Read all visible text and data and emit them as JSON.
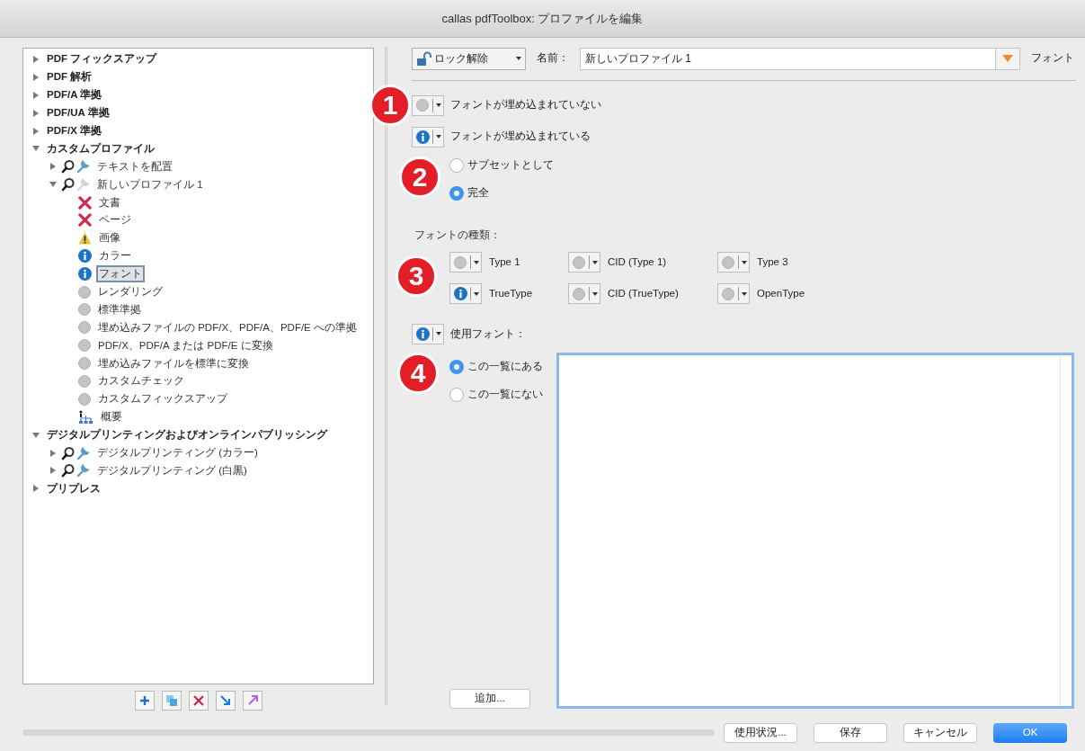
{
  "window": {
    "title": "callas pdfToolbox: プロファイルを編集"
  },
  "tree": [
    {
      "label": "PDF フィックスアップ",
      "expanded": false,
      "selected": false
    },
    {
      "label": "PDF 解析",
      "expanded": false,
      "selected": false
    },
    {
      "label": "PDF/A 準拠",
      "expanded": false,
      "selected": false
    },
    {
      "label": "PDF/UA 準拠",
      "expanded": false,
      "selected": false
    },
    {
      "label": "PDF/X 準拠",
      "expanded": false,
      "selected": false
    },
    {
      "label": "カスタムプロファイル",
      "expanded": true,
      "selected": false,
      "children": [
        {
          "label": "テキストを配置",
          "expanded": false,
          "selected": false,
          "kind": "profile",
          "fixups": true
        },
        {
          "label": "新しいプロファイル 1",
          "expanded": true,
          "selected": false,
          "kind": "profile",
          "fixups": false,
          "children": [
            {
              "label": "文書",
              "kind": "error",
              "selected": false
            },
            {
              "label": "ページ",
              "kind": "error",
              "selected": false
            },
            {
              "label": "画像",
              "kind": "warning",
              "selected": false
            },
            {
              "label": "カラー",
              "kind": "info",
              "selected": false
            },
            {
              "label": "フォント",
              "kind": "info",
              "selected": true
            },
            {
              "label": "レンダリング",
              "kind": "off",
              "selected": false
            },
            {
              "label": "標準準拠",
              "kind": "off",
              "selected": false
            },
            {
              "label": "埋め込みファイルの PDF/X、PDF/A、PDF/E への準拠",
              "kind": "off",
              "selected": false
            },
            {
              "label": "PDF/X、PDF/A または PDF/E に変換",
              "kind": "off",
              "selected": false
            },
            {
              "label": "埋め込みファイルを標準に変換",
              "kind": "off",
              "selected": false
            },
            {
              "label": "カスタムチェック",
              "kind": "off",
              "selected": false
            },
            {
              "label": "カスタムフィックスアップ",
              "kind": "off",
              "selected": false
            },
            {
              "label": "概要",
              "kind": "summary",
              "selected": false
            }
          ]
        }
      ]
    },
    {
      "label": "デジタルプリンティングおよびオンラインパブリッシング",
      "expanded": true,
      "selected": false,
      "children": [
        {
          "label": "デジタルプリンティング (カラー)",
          "expanded": false,
          "selected": false,
          "kind": "profile",
          "fixups": true
        },
        {
          "label": "デジタルプリンティング (白黒)",
          "expanded": false,
          "selected": false,
          "kind": "profile",
          "fixups": true
        }
      ]
    },
    {
      "label": "プリプレス",
      "expanded": false,
      "selected": false
    }
  ],
  "tree_toolbar": [
    {
      "kind": "add"
    },
    {
      "kind": "duplicate"
    },
    {
      "kind": "delete"
    },
    {
      "kind": "import"
    },
    {
      "kind": "export"
    }
  ],
  "editor": {
    "lock": "ロック解除",
    "name_label": "名前：",
    "name_value": "新しいプロファイル 1",
    "section": "フォント",
    "not_embedded": {
      "kind": "off",
      "label": "フォントが埋め込まれていない",
      "callout": "1"
    },
    "embedded": {
      "kind": "info",
      "label": "フォントが埋め込まれている",
      "callout": "2",
      "options": [
        {
          "label": "サブセットとして",
          "selected": false
        },
        {
          "label": "完全",
          "selected": true
        }
      ]
    },
    "font_types": {
      "label": "フォントの種類：",
      "callout": "3",
      "items": [
        {
          "label": "Type 1",
          "kind": "off"
        },
        {
          "label": "CID (Type 1)",
          "kind": "off"
        },
        {
          "label": "Type 3",
          "kind": "off"
        },
        {
          "label": "TrueType",
          "kind": "info"
        },
        {
          "label": "CID (TrueType)",
          "kind": "off"
        },
        {
          "label": "OpenType",
          "kind": "off"
        }
      ]
    },
    "used_fonts": {
      "kind": "info",
      "label": "使用フォント：",
      "callout": "4",
      "options": [
        {
          "label": "この一覧にある",
          "selected": true
        },
        {
          "label": "この一覧にない",
          "selected": false
        }
      ],
      "add_button": "追加..."
    }
  },
  "buttons": [
    {
      "label": "使用状況...",
      "primary": false
    },
    {
      "label": "保存",
      "primary": false
    },
    {
      "label": "キャンセル",
      "primary": false
    },
    {
      "label": "OK",
      "primary": true
    }
  ]
}
